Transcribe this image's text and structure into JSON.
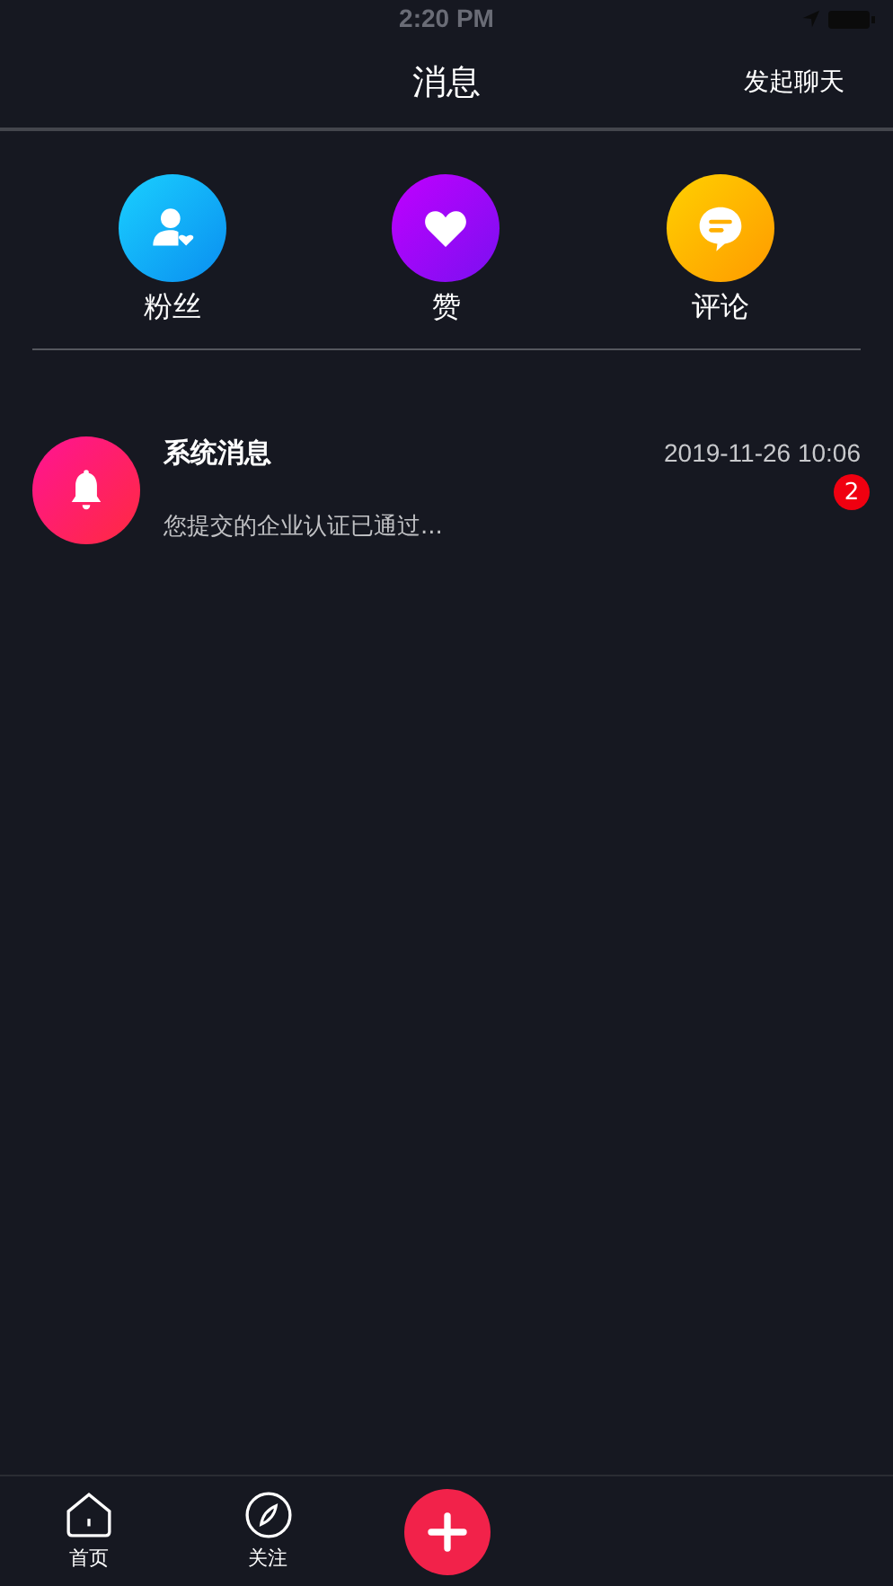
{
  "status_bar": {
    "time": "2:20 PM"
  },
  "header": {
    "title": "消息",
    "action": "发起聊天"
  },
  "categories": [
    {
      "kind": "fans",
      "label": "粉丝"
    },
    {
      "kind": "likes",
      "label": "赞"
    },
    {
      "kind": "comments",
      "label": "评论"
    }
  ],
  "messages": [
    {
      "kind": "system",
      "title": "系统消息",
      "time": "2019-11-26 10:06",
      "preview": "您提交的企业认证已通过...",
      "badge": "2"
    }
  ],
  "tab_bar": [
    {
      "kind": "home",
      "label": "首页"
    },
    {
      "kind": "follow",
      "label": "关注"
    },
    {
      "kind": "add"
    }
  ]
}
